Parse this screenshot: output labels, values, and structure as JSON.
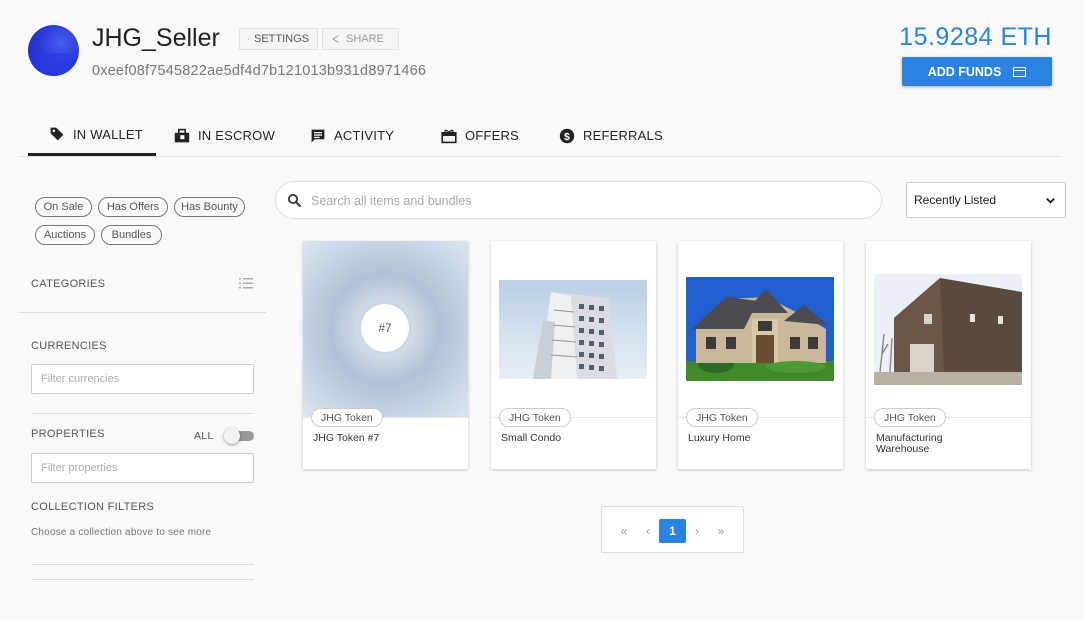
{
  "profile": {
    "username": "JHG_Seller",
    "address": "0xeef08f7545822ae5df4d7b121013b931d8971466",
    "settings_label": "SETTINGS",
    "share_label": "SHARE",
    "balance": "15.9284 ETH",
    "add_funds_label": "ADD FUNDS"
  },
  "tabs": [
    {
      "label": "IN WALLET",
      "icon": "tag-icon",
      "active": true
    },
    {
      "label": "IN ESCROW",
      "icon": "briefcase-icon",
      "active": false
    },
    {
      "label": "ACTIVITY",
      "icon": "chat-icon",
      "active": false
    },
    {
      "label": "OFFERS",
      "icon": "gift-icon",
      "active": false
    },
    {
      "label": "REFERRALS",
      "icon": "dollar-icon",
      "active": false
    }
  ],
  "sidebar": {
    "chips": [
      "On Sale",
      "Has Offers",
      "Has Bounty",
      "Auctions",
      "Bundles"
    ],
    "categories_label": "CATEGORIES",
    "currencies_label": "CURRENCIES",
    "currencies_placeholder": "Filter currencies",
    "properties_label": "PROPERTIES",
    "properties_all_label": "ALL",
    "properties_placeholder": "Filter properties",
    "collection_filters_label": "COLLECTION FILTERS",
    "collection_filters_hint": "Choose a collection above to see more"
  },
  "search": {
    "placeholder": "Search all items and bundles"
  },
  "sort": {
    "selected": "Recently Listed"
  },
  "items": [
    {
      "collection": "JHG Token",
      "name": "JHG Token #7",
      "badge": "#7"
    },
    {
      "collection": "JHG Token",
      "name": "Small Condo"
    },
    {
      "collection": "JHG Token",
      "name": "Luxury Home"
    },
    {
      "collection": "JHG Token",
      "name": "Manufacturing Warehouse"
    }
  ],
  "pagination": {
    "first": "«",
    "prev": "‹",
    "current": "1",
    "next": "›",
    "last": "»"
  },
  "colors": {
    "accent": "#2a83e0"
  }
}
